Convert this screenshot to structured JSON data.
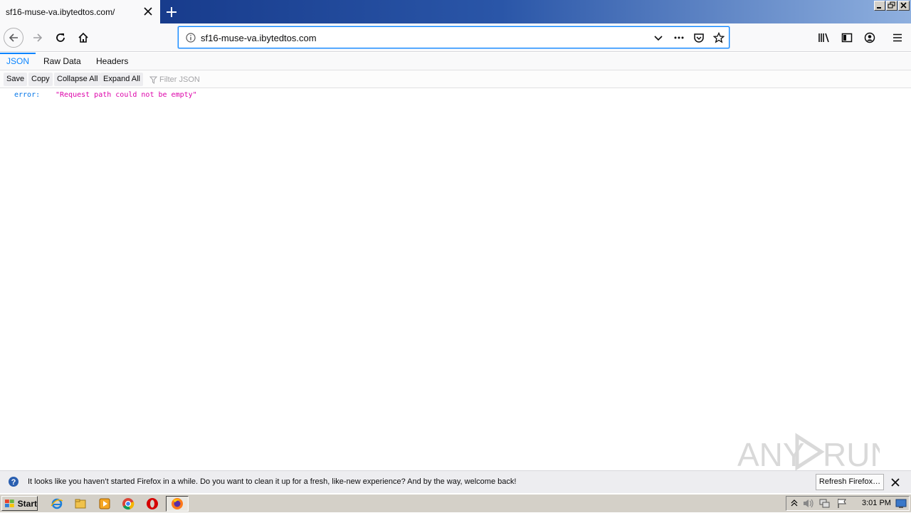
{
  "browser": {
    "tab_title": "sf16-muse-va.ibytedtos.com/",
    "url": "sf16-muse-va.ibytedtos.com"
  },
  "viewer_tabs": [
    {
      "label": "JSON",
      "active": true
    },
    {
      "label": "Raw Data",
      "active": false
    },
    {
      "label": "Headers",
      "active": false
    }
  ],
  "toolbar": {
    "save_label": "Save",
    "copy_label": "Copy",
    "collapse_label": "Collapse All",
    "expand_label": "Expand All",
    "filter_placeholder": "Filter JSON"
  },
  "json_rows": [
    {
      "key": "error:",
      "value": "\"Request path could not be empty\""
    }
  ],
  "notification": {
    "message": "It looks like you haven’t started Firefox in a while. Do you want to clean it up for a fresh, like-new experience? And by the way, welcome back!",
    "button_label": "Refresh Firefox…"
  },
  "taskbar": {
    "start_label": "Start",
    "clock": "3:01 PM"
  },
  "watermark": {
    "text": "ANY RUN"
  },
  "colors": {
    "accent": "#0a84ff",
    "json_key": "#0074e8",
    "json_string": "#dd00a9"
  }
}
